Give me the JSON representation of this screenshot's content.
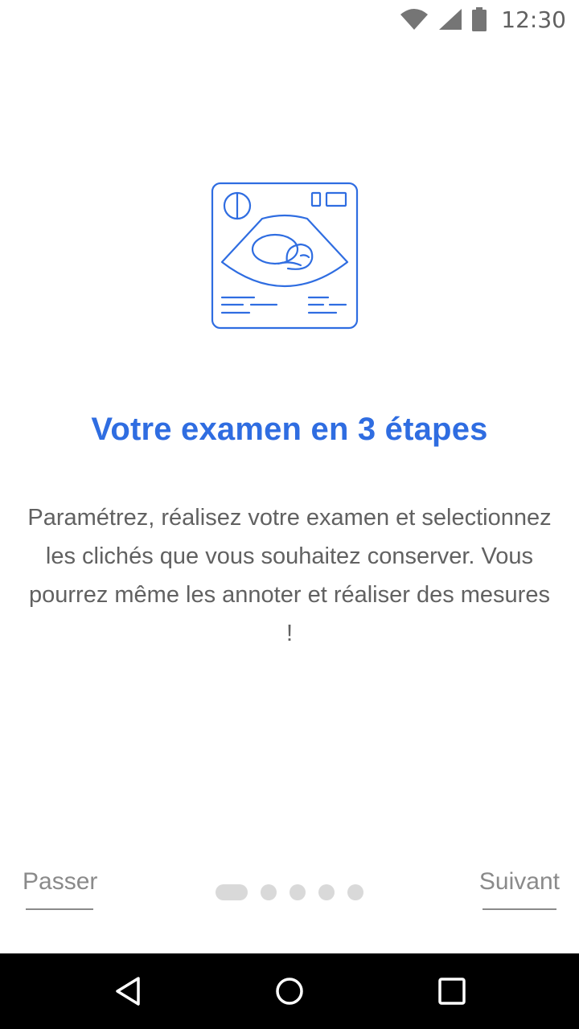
{
  "status_bar": {
    "time": "12:30",
    "icons": [
      "wifi-icon",
      "cell-signal-icon",
      "battery-icon"
    ]
  },
  "onboarding": {
    "illustration": "ultrasound-scan-icon",
    "title": "Votre examen en 3 étapes",
    "description": "Paramétrez, réalisez votre examen et selectionnez les clichés que vous souhaitez conserver.  Vous pourrez même les annoter et réaliser des mesures !",
    "skip_label": "Passer",
    "next_label": "Suivant",
    "page_count": 5,
    "current_page": 1
  },
  "navigation_bar": {
    "buttons": [
      "back-icon",
      "home-icon",
      "recents-icon"
    ]
  },
  "colors": {
    "accent": "#2f6de1",
    "body_text": "#616161",
    "muted": "#8a8a8a",
    "dot": "#d9d9d9"
  }
}
